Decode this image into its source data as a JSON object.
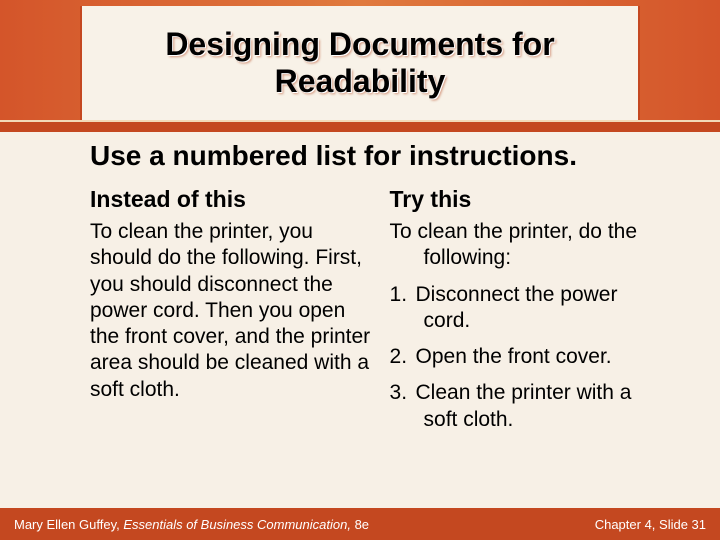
{
  "title": "Designing Documents for Readability",
  "heading": "Use a numbered list for instructions.",
  "left": {
    "label": "Instead of this",
    "body": "To clean the printer, you should do the following. First, you should disconnect the power cord. Then you open the front cover, and the printer area should be cleaned with a soft cloth."
  },
  "right": {
    "label": "Try this",
    "lead": "To clean the printer, do the following:",
    "steps": [
      "Disconnect the power cord.",
      "Open the front cover.",
      "Clean the printer with a soft cloth."
    ]
  },
  "footer": {
    "author": "Mary Ellen Guffey, ",
    "book": "Essentials of Business Communication, ",
    "edition": "8e",
    "pageref": "Chapter 4, Slide 31"
  }
}
